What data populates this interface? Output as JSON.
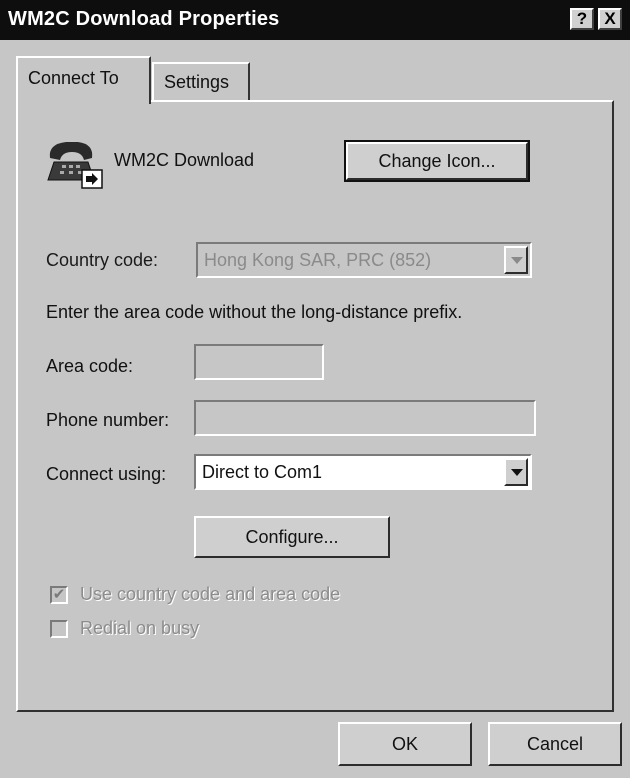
{
  "window": {
    "title": "WM2C Download Properties"
  },
  "titlebar_buttons": {
    "help": "?",
    "close": "X"
  },
  "tabs": [
    {
      "label": "Connect To",
      "selected": true
    },
    {
      "label": "Settings",
      "selected": false
    }
  ],
  "connection": {
    "icon": "telephone-icon",
    "name": "WM2C Download",
    "change_icon_button": "Change Icon..."
  },
  "country": {
    "label": "Country code:",
    "value": "Hong Kong SAR, PRC (852)",
    "enabled": false
  },
  "instruction": "Enter the area code without the long-distance prefix.",
  "area_code": {
    "label": "Area code:",
    "value": ""
  },
  "phone_number": {
    "label": "Phone number:",
    "value": ""
  },
  "connect_using": {
    "label": "Connect using:",
    "value": "Direct to Com1"
  },
  "configure_button": "Configure...",
  "options": [
    {
      "label": "Use country code and area code",
      "checked": true,
      "enabled": false
    },
    {
      "label": "Redial on busy",
      "checked": false,
      "enabled": false
    }
  ],
  "footer": {
    "ok": "OK",
    "cancel": "Cancel"
  }
}
